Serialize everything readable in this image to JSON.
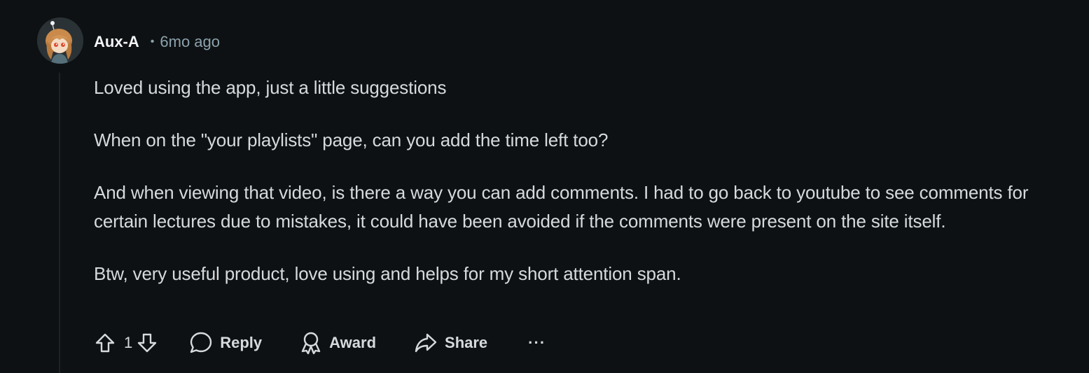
{
  "comment": {
    "author": "Aux-A",
    "separator": "•",
    "age": "6mo ago",
    "paragraphs": [
      "Loved using the app, just a little suggestions",
      "When on the \"your playlists\" page, can you add the time left too?",
      "And when viewing that video, is there a way you can add comments. I had to go back to youtube to see comments for certain lectures due to mistakes, it could have been avoided if the comments were present on the site itself.",
      "Btw, very useful product, love using and helps for my short attention span."
    ]
  },
  "actions": {
    "score": "1",
    "reply_label": "Reply",
    "award_label": "Award",
    "share_label": "Share",
    "more_label": "···"
  },
  "icons": {
    "upvote": "upvote-arrow-icon",
    "downvote": "downvote-arrow-icon",
    "reply": "speech-bubble-icon",
    "award": "award-ribbon-icon",
    "share": "share-arrow-icon"
  },
  "colors": {
    "background": "#0e1113",
    "text": "#d7dadc",
    "meta": "#8ba2ad",
    "thread_line": "#1c2226"
  }
}
